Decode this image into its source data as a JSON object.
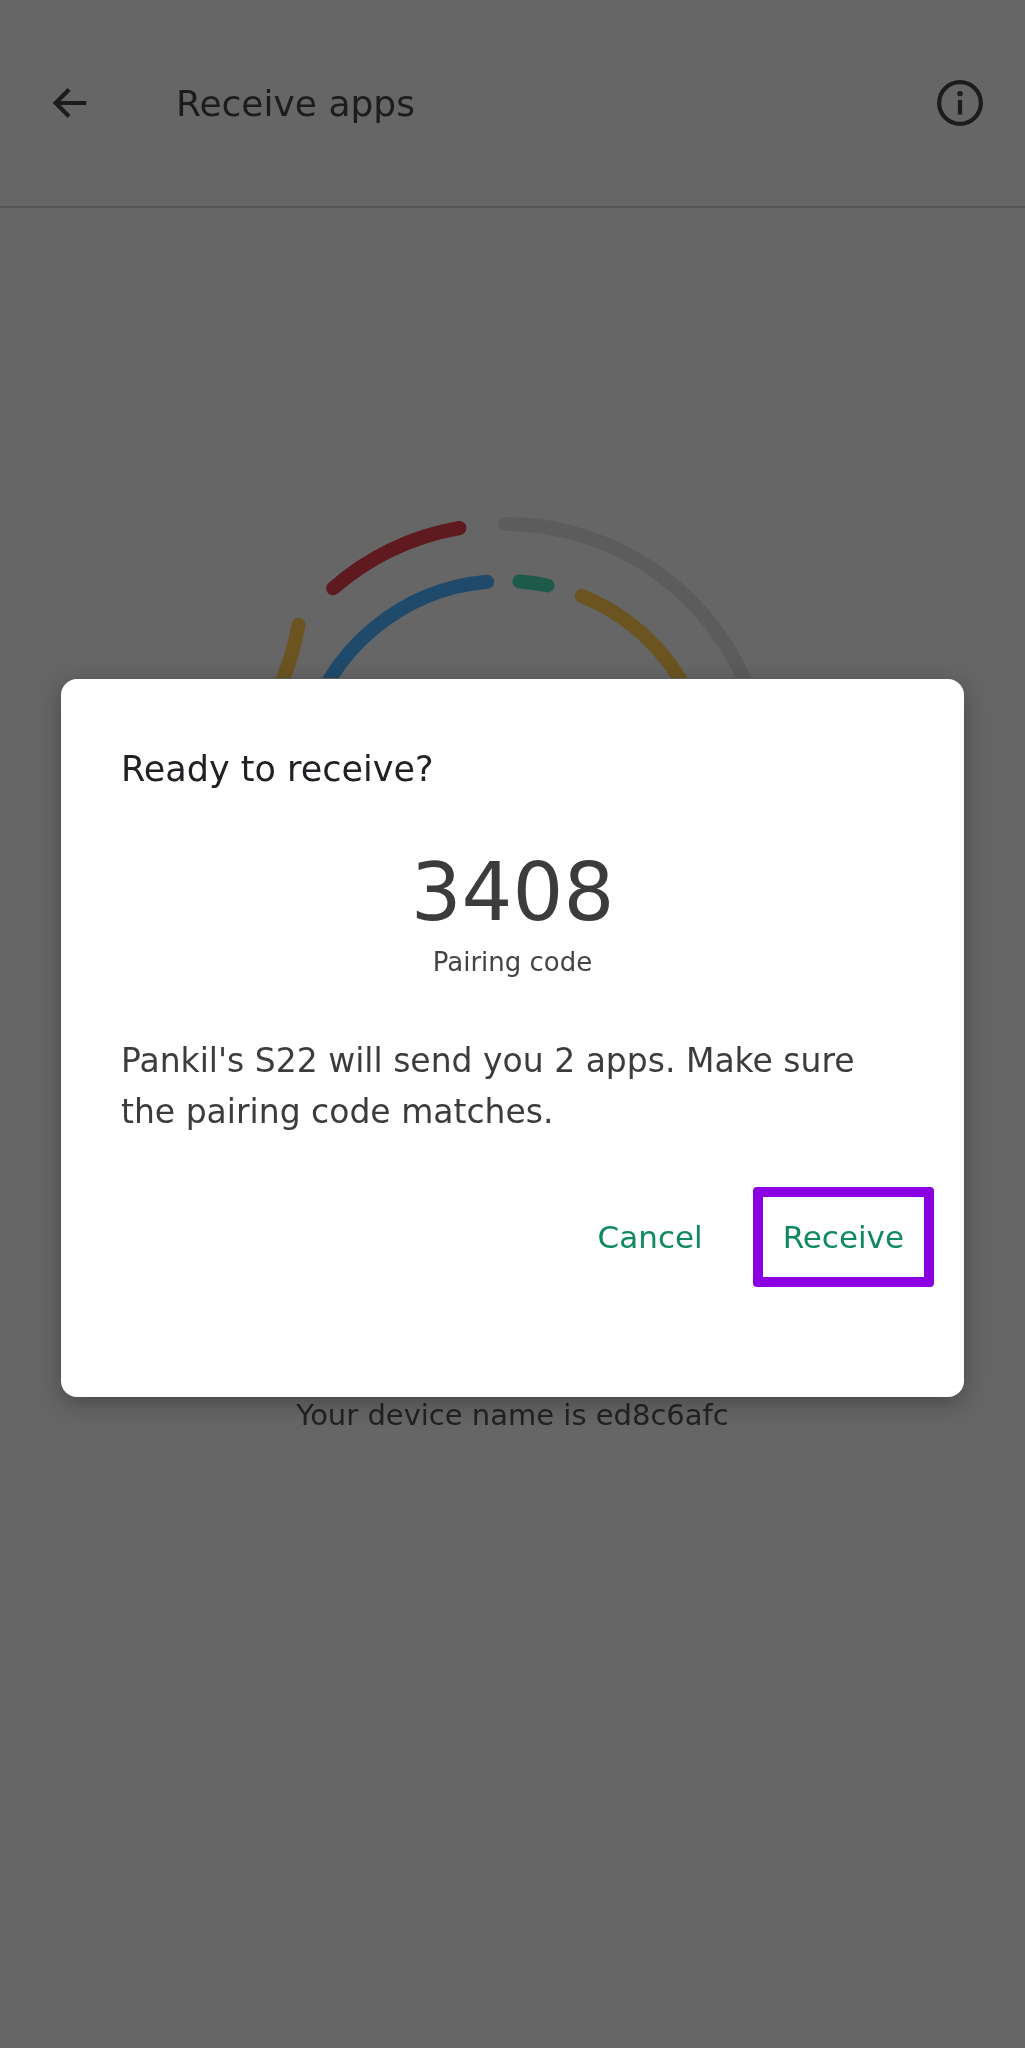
{
  "app_bar": {
    "title": "Receive apps"
  },
  "device_name": "Your device name is ed8c6afc",
  "dialog": {
    "title": "Ready to receive?",
    "pairing_code": "3408",
    "pairing_label": "Pairing code",
    "message": "Pankil's S22 will send you 2 apps. Make sure the pairing code matches.",
    "buttons": [
      {
        "label": "Cancel",
        "highlighted": false
      },
      {
        "label": "Receive",
        "highlighted": true
      }
    ]
  }
}
